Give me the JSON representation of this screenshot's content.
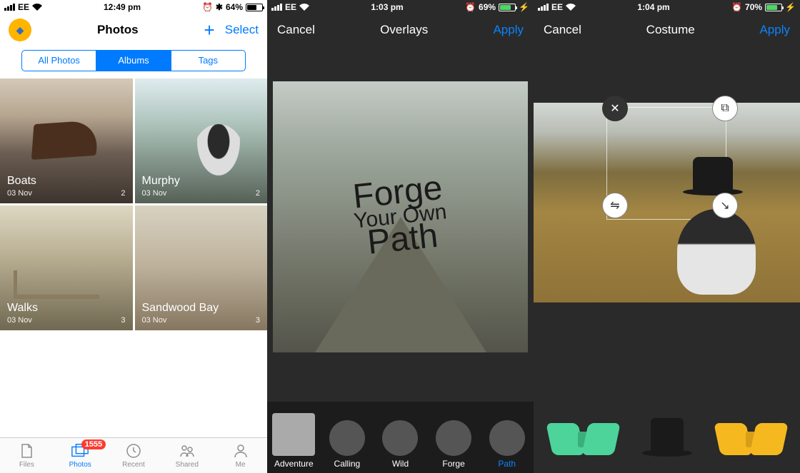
{
  "screen1": {
    "status": {
      "carrier": "EE",
      "time": "12:49 pm",
      "battery": "64%"
    },
    "header": {
      "title": "Photos",
      "select": "Select"
    },
    "segments": [
      "All Photos",
      "Albums",
      "Tags"
    ],
    "segment_active": 1,
    "albums": [
      {
        "name": "Boats",
        "date": "03 Nov",
        "count": "2"
      },
      {
        "name": "Murphy",
        "date": "03 Nov",
        "count": "2"
      },
      {
        "name": "Walks",
        "date": "03 Nov",
        "count": "3"
      },
      {
        "name": "Sandwood Bay",
        "date": "03 Nov",
        "count": "3"
      }
    ],
    "tabs": [
      {
        "label": "Files"
      },
      {
        "label": "Photos",
        "badge": "1555"
      },
      {
        "label": "Recent"
      },
      {
        "label": "Shared"
      },
      {
        "label": "Me"
      }
    ],
    "tab_active": 1
  },
  "screen2": {
    "status": {
      "carrier": "EE",
      "time": "1:03 pm",
      "battery": "69%"
    },
    "nav": {
      "cancel": "Cancel",
      "title": "Overlays",
      "apply": "Apply"
    },
    "overlay_text": {
      "l1": "Forge",
      "l2": "Your Own",
      "l3": "Path"
    },
    "thumbs": [
      {
        "label": "Adventure"
      },
      {
        "label": "Calling"
      },
      {
        "label": "Wild"
      },
      {
        "label": "Forge"
      },
      {
        "label": "Path"
      }
    ],
    "thumb_selected": 4
  },
  "screen3": {
    "status": {
      "carrier": "EE",
      "time": "1:04 pm",
      "battery": "70%"
    },
    "nav": {
      "cancel": "Cancel",
      "title": "Costume",
      "apply": "Apply"
    },
    "items": [
      "bowtie-green",
      "top-hat",
      "bowtie-yellow"
    ]
  }
}
